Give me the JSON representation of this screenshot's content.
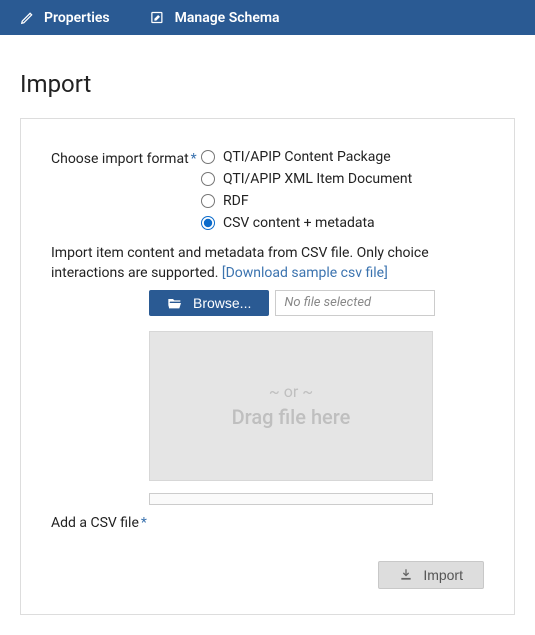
{
  "topbar": {
    "properties_label": "Properties",
    "manage_schema_label": "Manage Schema"
  },
  "page_title": "Import",
  "format_field": {
    "label": "Choose import format",
    "options": [
      {
        "label": "QTI/APIP Content Package",
        "selected": false
      },
      {
        "label": "QTI/APIP XML Item Document",
        "selected": false
      },
      {
        "label": "RDF",
        "selected": false
      },
      {
        "label": "CSV content + metadata",
        "selected": true
      }
    ]
  },
  "helptext": {
    "text": "Import item content and metadata from CSV file. Only choice interactions are supported. ",
    "link_text": "[Download sample csv file]"
  },
  "browse": {
    "button_label": "Browse...",
    "file_placeholder": "No file selected"
  },
  "drop": {
    "or_text": "~ or ~",
    "drag_text": "Drag file here"
  },
  "add_csv_label": "Add a CSV file",
  "import_button_label": "Import"
}
